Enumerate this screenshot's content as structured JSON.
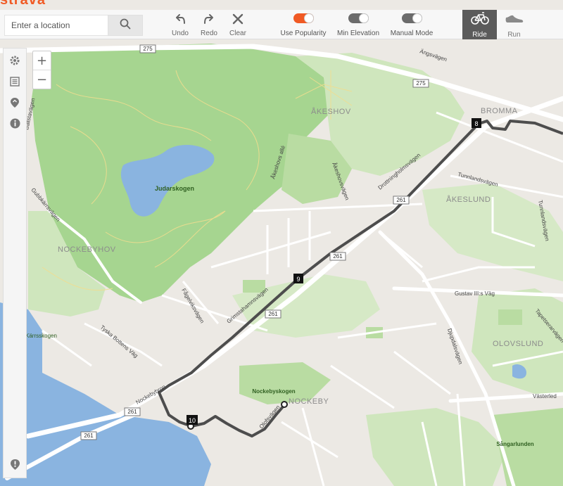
{
  "app": {
    "logo_text": "strava"
  },
  "search": {
    "placeholder": "Enter a location",
    "value": ""
  },
  "tools": {
    "undo_label": "Undo",
    "redo_label": "Redo",
    "clear_label": "Clear"
  },
  "toggles": [
    {
      "label": "Use Popularity",
      "state": "on"
    },
    {
      "label": "Min Elevation",
      "state": "off"
    },
    {
      "label": "Manual Mode",
      "state": "off"
    }
  ],
  "modes": [
    {
      "label": "Ride",
      "icon": "bike-icon",
      "active": true
    },
    {
      "label": "Run",
      "icon": "shoe-icon",
      "active": false
    }
  ],
  "sidebar": {
    "items": [
      {
        "icon": "gear-icon"
      },
      {
        "icon": "list-icon"
      },
      {
        "icon": "route-pin-icon"
      },
      {
        "icon": "info-icon"
      }
    ],
    "bottom_icon": "alert-icon"
  },
  "zoom": {
    "in": "+",
    "out": "−"
  },
  "map": {
    "places": [
      "ÅKESHOV",
      "BROMMA",
      "ÅKESLUND",
      "NOCKEBYHOV",
      "OLOVSLUND",
      "NOCKEBY"
    ],
    "lakes": [
      "Judarskogen"
    ],
    "parks": [
      "Nockebyskogen",
      "Sångarlunden",
      "Kärrsskogen"
    ],
    "roads": [
      "Bällstavägen",
      "Gubbkärrsvägen",
      "Åkeshovs allé",
      "Åkeshovsvägen",
      "Drottningholmsvägen",
      "Tunnlandsvägen",
      "Gustav III:s Väg",
      "Djupdalsvägen",
      "Västerled",
      "Tapetserarvägen",
      "Grimstahamnsvägen",
      "Fågelviksvägen",
      "Tyska Bottens Väg",
      "Nockebybron",
      "Ängsvägen",
      "Olofsvägen",
      "Tunnlandsvägen"
    ],
    "route_numbers": [
      "275",
      "275",
      "261",
      "261",
      "261",
      "261",
      "261"
    ],
    "route_markers": [
      "8",
      "9",
      "10"
    ],
    "colors": {
      "park": "#c8e3b0",
      "forest": "#9fd18a",
      "water": "#8ab4e0",
      "route": "#4a4a4a",
      "land": "#ece9e4"
    }
  }
}
